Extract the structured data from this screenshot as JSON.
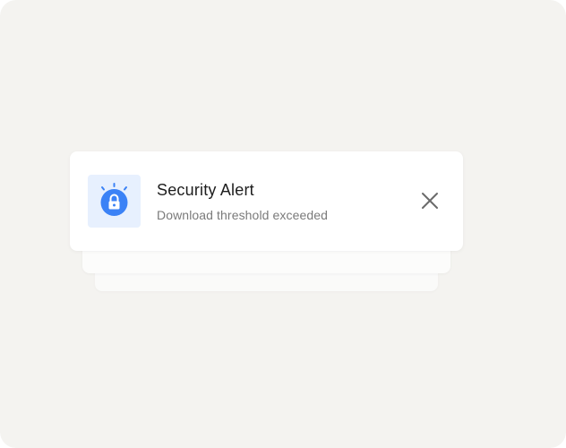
{
  "notification": {
    "title": "Security Alert",
    "message": "Download threshold exceeded",
    "icon": "lock-alert-icon",
    "close_icon": "close-icon",
    "colors": {
      "accent": "#3b82f6",
      "icon_tile_bg": "#e7f0fe",
      "title": "#1d1d1d",
      "message": "#7a7a7a",
      "background": "#f4f3f0"
    }
  }
}
